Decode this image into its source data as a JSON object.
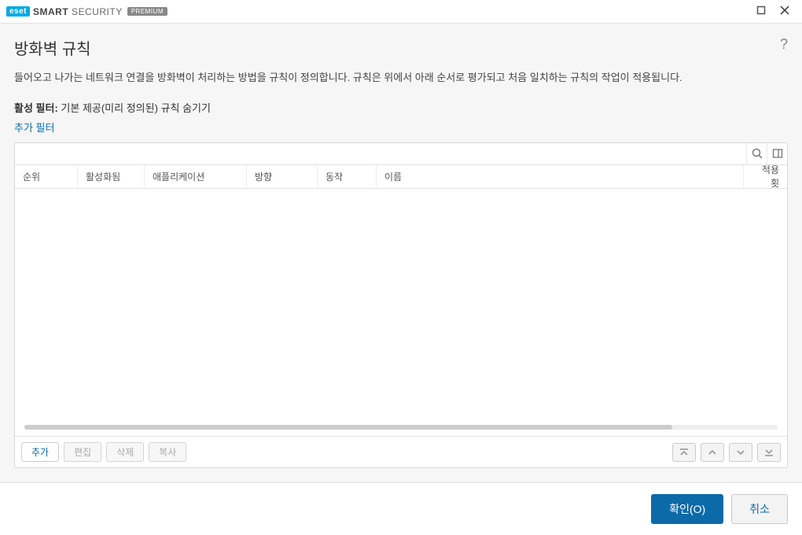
{
  "brand": {
    "logo": "eset",
    "name_left": "SMART",
    "name_right": "SECURITY",
    "badge": "PREMIUM"
  },
  "page": {
    "title": "방화벽 규칙",
    "description": "들어오고 나가는 네트워크 연결을 방화벽이 처리하는 방법을 규칙이 정의합니다. 규칙은 위에서 아래 순서로 평가되고 처음 일치하는 규칙의 작업이 적용됩니다.",
    "filter_label": "활성 필터:",
    "filter_value": "기본 제공(미리 정의된) 규칙 숨기기",
    "add_filter": "추가 필터"
  },
  "search": {
    "placeholder": ""
  },
  "columns": {
    "priority": "순위",
    "enabled": "활성화됨",
    "application": "애플리케이션",
    "direction": "방향",
    "action": "동작",
    "name": "이름",
    "hits": "적용 횟"
  },
  "rows": [],
  "actions": {
    "add": "추가",
    "edit": "편집",
    "delete": "삭제",
    "copy": "복사"
  },
  "footer": {
    "ok": "확인(O)",
    "cancel": "취소"
  }
}
